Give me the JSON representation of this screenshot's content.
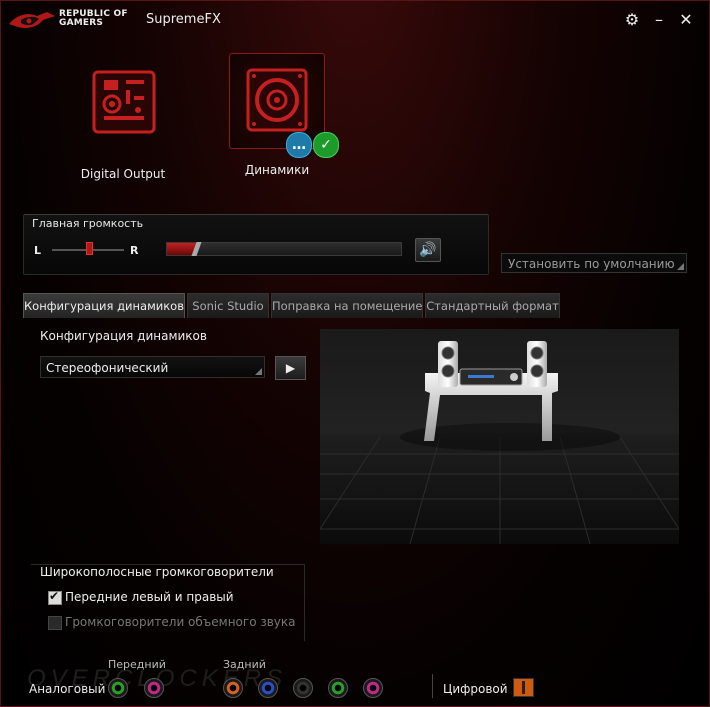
{
  "window": {
    "brand_line1": "REPUBLIC OF",
    "brand_line2": "GAMERS",
    "title": "SupremeFX",
    "icons": [
      "settings-gear-icon",
      "minimize-icon",
      "close-icon"
    ]
  },
  "devices": [
    {
      "label": "Digital Output",
      "icon": "digital-output-icon",
      "selected": false
    },
    {
      "label": "Динамики",
      "icon": "speaker-icon",
      "selected": true,
      "badges": [
        "chat-bubble-icon",
        "checkmark-icon"
      ]
    }
  ],
  "volume": {
    "title": "Главная громкость",
    "balance_left": "L",
    "balance_right": "R",
    "level_fraction": 0.13,
    "balance_fraction": 0.5,
    "mute_icon": "speaker-volume-icon"
  },
  "default_button": "Установить по умолчанию",
  "tabs": [
    "Конфигурация динамиков",
    "Sonic Studio",
    "Поправка на помещение",
    "Стандартный формат"
  ],
  "active_tab": 0,
  "speaker_config": {
    "label": "Конфигурация динамиков",
    "selected": "Стереофонический",
    "play_icon": "play-icon"
  },
  "fullrange": {
    "title": "Широкополосные громкоговорители",
    "front_label": "Передние левый и правый",
    "front_checked": true,
    "surround_label": "Громкоговорители объемного звука",
    "surround_checked": false
  },
  "jacks": {
    "front_label": "Передний",
    "rear_label": "Задний",
    "analog_label": "Аналоговый",
    "digital_label": "Цифровой",
    "front_colors": [
      "#28a028",
      "#c0288c"
    ],
    "rear_colors": [
      "#d86020",
      "#2850c8",
      "#333333",
      "#28a028",
      "#c0288c"
    ],
    "watermark": "OVERCLOCKERS"
  },
  "colors": {
    "accent": "#c22020",
    "background": "#0a0202"
  }
}
